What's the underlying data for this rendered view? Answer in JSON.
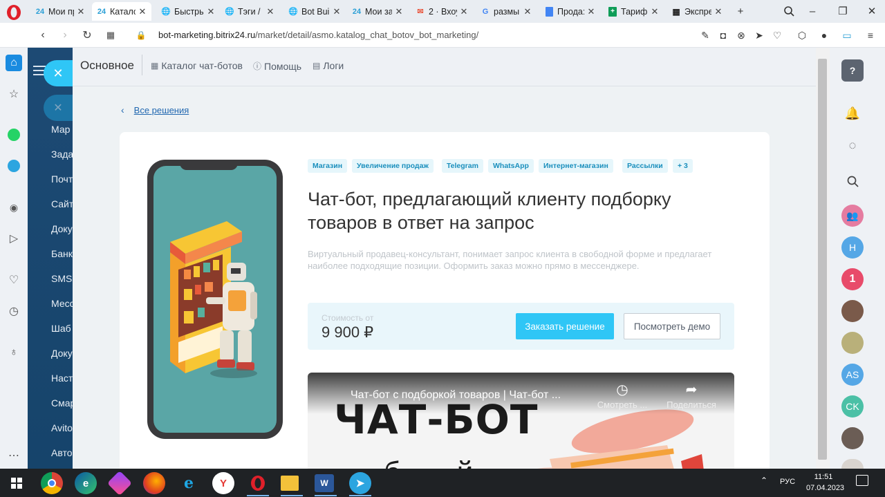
{
  "browser": {
    "tabs": [
      {
        "label": "Мои пр",
        "icon": "24",
        "icon_color": "#2fc6f6"
      },
      {
        "label": "Катало",
        "icon": "24",
        "icon_color": "#2fc6f6",
        "active": true
      },
      {
        "label": "Быстрь",
        "icon": "globe",
        "icon_color": "#555"
      },
      {
        "label": "Тэги / ",
        "icon": "globe",
        "icon_color": "#555"
      },
      {
        "label": "Bot Bui",
        "icon": "globe",
        "icon_color": "#555"
      },
      {
        "label": "Мои за",
        "icon": "24",
        "icon_color": "#2fc6f6"
      },
      {
        "label": "2 · Вхоу",
        "icon": "mail",
        "icon_color": "#e9573f"
      },
      {
        "label": "размы",
        "icon": "G",
        "icon_color": "#4285f4"
      },
      {
        "label": "Прода:",
        "icon": "doc",
        "icon_color": "#4285f4"
      },
      {
        "label": "Тариф",
        "icon": "sheet",
        "icon_color": "#0f9d58"
      },
      {
        "label": "Экспре",
        "icon": "grid",
        "icon_color": "#555"
      }
    ],
    "new_tab": "+",
    "url_host": "bot-marketing.bitrix24.ru",
    "url_path": "/market/detail/asmo.katalog_chat_botov_bot_marketing/"
  },
  "b24_menu": {
    "items": [
      "Мар",
      "Зада",
      "Почт",
      "Сайт",
      "Доку",
      "Банк",
      "SMS",
      "Месс",
      "Шаб",
      "Доку",
      "Наст",
      "Смар",
      "Avito",
      "Авто"
    ]
  },
  "slider_header": {
    "title": "Основное",
    "links": [
      {
        "label": "Каталог чат-ботов",
        "icon": "grid-icon"
      },
      {
        "label": "Помощь",
        "icon": "help-icon"
      },
      {
        "label": "Логи",
        "icon": "log-icon"
      }
    ]
  },
  "page": {
    "back_label": "Все решения",
    "tags": [
      "Магазин",
      "Увеличение продаж",
      "Telegram",
      "WhatsApp",
      "Интернет-магазин",
      "Рассылки",
      "+ 3"
    ],
    "title": "Чат-бот, предлагающий клиенту подборку товаров в ответ на запрос",
    "description": "Виртуальный продавец-консультант, понимает запрос клиента в свободной форме и предлагает наиболее подходящие позиции. Оформить заказ можно прямо в мессенджере.",
    "price_label": "Стоимость от",
    "price_value": "9 900 ₽",
    "order_button": "Заказать решение",
    "demo_button": "Посмотреть демо",
    "video": {
      "title": "Чат-бот с подборкой товаров | Чат-бот ...",
      "watch_later": "Смотреть ...",
      "share": "Поделиться",
      "big_text": "ЧАТ-БОТ",
      "sub_text": "б       й"
    }
  },
  "right_panel": {
    "avatars": [
      {
        "label": "H",
        "color": "#55a7e6"
      },
      {
        "label": "1",
        "color": "#e84b6a"
      },
      {
        "label": "AS",
        "color": "#55a7e6"
      },
      {
        "label": "CK",
        "color": "#4bc0a6"
      }
    ]
  },
  "taskbar": {
    "lang": "РУС",
    "time": "11:51",
    "date": "07.04.2023"
  },
  "colors": {
    "accent": "#2fc6f6",
    "link": "#2067b0",
    "menu_bg": "#1d4a74"
  }
}
